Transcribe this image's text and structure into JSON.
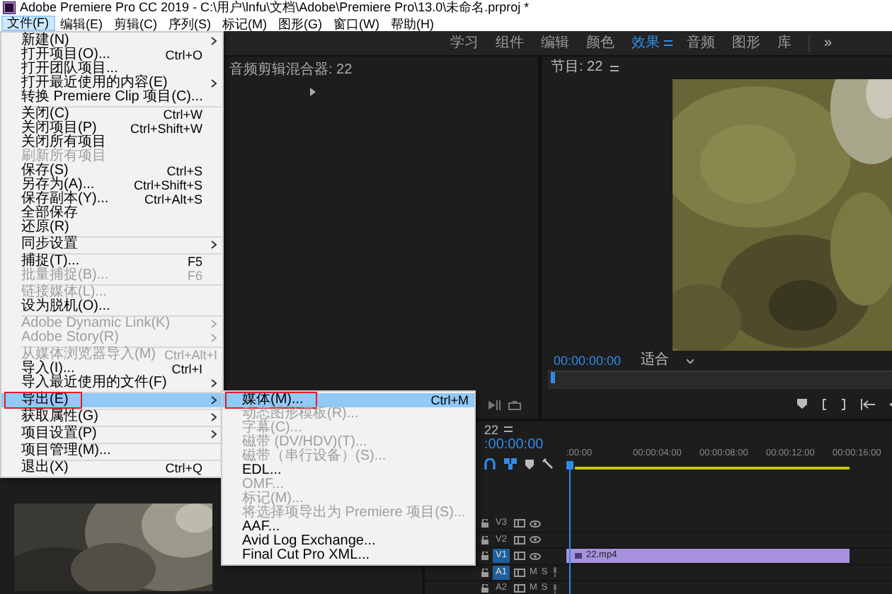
{
  "window": {
    "title": "Adobe Premiere Pro CC 2019 - C:\\用户\\lnfu\\文档\\Adobe\\Premiere Pro\\13.0\\未命名.prproj *"
  },
  "menu_bar": [
    {
      "label": "文件(F)",
      "selected": true
    },
    {
      "label": "编辑(E)",
      "selected": false
    },
    {
      "label": "剪辑(C)",
      "selected": false
    },
    {
      "label": "序列(S)",
      "selected": false
    },
    {
      "label": "标记(M)",
      "selected": false
    },
    {
      "label": "图形(G)",
      "selected": false
    },
    {
      "label": "窗口(W)",
      "selected": false
    },
    {
      "label": "帮助(H)",
      "selected": false
    }
  ],
  "file_menu": [
    {
      "kind": "item",
      "label": "新建(N)",
      "submenu": true,
      "disabled": false,
      "selected": false
    },
    {
      "kind": "item",
      "label": "打开项目(O)...",
      "shortcut": "Ctrl+O",
      "submenu": false,
      "disabled": false,
      "selected": false
    },
    {
      "kind": "item",
      "label": "打开团队项目...",
      "submenu": false,
      "disabled": false,
      "selected": false
    },
    {
      "kind": "item",
      "label": "打开最近使用的内容(E)",
      "submenu": true,
      "disabled": false,
      "selected": false
    },
    {
      "kind": "item",
      "label": "转换 Premiere Clip 项目(C)...",
      "submenu": false,
      "disabled": false,
      "selected": false
    },
    {
      "kind": "separator"
    },
    {
      "kind": "item",
      "label": "关闭(C)",
      "shortcut": "Ctrl+W",
      "submenu": false,
      "disabled": false,
      "selected": false
    },
    {
      "kind": "item",
      "label": "关闭项目(P)",
      "shortcut": "Ctrl+Shift+W",
      "submenu": false,
      "disabled": false,
      "selected": false
    },
    {
      "kind": "item",
      "label": "关闭所有项目",
      "submenu": false,
      "disabled": false,
      "selected": false
    },
    {
      "kind": "item",
      "label": "刷新所有项目",
      "submenu": false,
      "disabled": true,
      "selected": false
    },
    {
      "kind": "item",
      "label": "保存(S)",
      "shortcut": "Ctrl+S",
      "submenu": false,
      "disabled": false,
      "selected": false
    },
    {
      "kind": "item",
      "label": "另存为(A)...",
      "shortcut": "Ctrl+Shift+S",
      "submenu": false,
      "disabled": false,
      "selected": false
    },
    {
      "kind": "item",
      "label": "保存副本(Y)...",
      "shortcut": "Ctrl+Alt+S",
      "submenu": false,
      "disabled": false,
      "selected": false
    },
    {
      "kind": "item",
      "label": "全部保存",
      "submenu": false,
      "disabled": false,
      "selected": false
    },
    {
      "kind": "item",
      "label": "还原(R)",
      "submenu": false,
      "disabled": false,
      "selected": false
    },
    {
      "kind": "separator"
    },
    {
      "kind": "item",
      "label": "同步设置",
      "submenu": true,
      "disabled": false,
      "selected": false
    },
    {
      "kind": "separator"
    },
    {
      "kind": "item",
      "label": "捕捉(T)...",
      "shortcut": "F5",
      "submenu": false,
      "disabled": false,
      "selected": false
    },
    {
      "kind": "item",
      "label": "批量捕捉(B)...",
      "shortcut": "F6",
      "submenu": false,
      "disabled": true,
      "selected": false
    },
    {
      "kind": "separator"
    },
    {
      "kind": "item",
      "label": "链接媒体(L)...",
      "submenu": false,
      "disabled": true,
      "selected": false
    },
    {
      "kind": "item",
      "label": "设为脱机(O)...",
      "submenu": false,
      "disabled": false,
      "selected": false
    },
    {
      "kind": "separator"
    },
    {
      "kind": "item",
      "label": "Adobe Dynamic Link(K)",
      "submenu": true,
      "disabled": true,
      "selected": false
    },
    {
      "kind": "item",
      "label": "Adobe Story(R)",
      "submenu": true,
      "disabled": true,
      "selected": false
    },
    {
      "kind": "separator"
    },
    {
      "kind": "item",
      "label": "从媒体浏览器导入(M)",
      "shortcut": "Ctrl+Alt+I",
      "submenu": false,
      "disabled": true,
      "selected": false
    },
    {
      "kind": "item",
      "label": "导入(I)...",
      "shortcut": "Ctrl+I",
      "submenu": false,
      "disabled": false,
      "selected": false
    },
    {
      "kind": "item",
      "label": "导入最近使用的文件(F)",
      "submenu": true,
      "disabled": false,
      "selected": false
    },
    {
      "kind": "separator"
    },
    {
      "kind": "item",
      "label": "导出(E)",
      "submenu": true,
      "disabled": false,
      "selected": true,
      "annotated": true
    },
    {
      "kind": "separator"
    },
    {
      "kind": "item",
      "label": "获取属性(G)",
      "submenu": true,
      "disabled": false,
      "selected": false
    },
    {
      "kind": "separator"
    },
    {
      "kind": "item",
      "label": "项目设置(P)",
      "submenu": true,
      "disabled": false,
      "selected": false
    },
    {
      "kind": "separator"
    },
    {
      "kind": "item",
      "label": "项目管理(M)...",
      "submenu": false,
      "disabled": false,
      "selected": false
    },
    {
      "kind": "separator"
    },
    {
      "kind": "item",
      "label": "退出(X)",
      "shortcut": "Ctrl+Q",
      "submenu": false,
      "disabled": false,
      "selected": false
    }
  ],
  "export_submenu": [
    {
      "kind": "item",
      "label": "媒体(M)...",
      "shortcut": "Ctrl+M",
      "disabled": false,
      "selected": true,
      "annotated": true
    },
    {
      "kind": "item",
      "label": "动态图形模板(R)...",
      "disabled": true,
      "selected": false
    },
    {
      "kind": "item",
      "label": "字幕(C)...",
      "disabled": true,
      "selected": false
    },
    {
      "kind": "item",
      "label": "磁带 (DV/HDV)(T)...",
      "disabled": true,
      "selected": false
    },
    {
      "kind": "item",
      "label": "磁带（串行设备）(S)...",
      "disabled": true,
      "selected": false
    },
    {
      "kind": "item",
      "label": "EDL...",
      "disabled": false,
      "selected": false
    },
    {
      "kind": "item",
      "label": "OMF...",
      "disabled": true,
      "selected": false
    },
    {
      "kind": "item",
      "label": "标记(M)...",
      "disabled": true,
      "selected": false
    },
    {
      "kind": "item",
      "label": "将选择项导出为 Premiere 项目(S)...",
      "disabled": true,
      "selected": false
    },
    {
      "kind": "item",
      "label": "AAF...",
      "disabled": false,
      "selected": false
    },
    {
      "kind": "item",
      "label": "Avid Log Exchange...",
      "disabled": false,
      "selected": false
    },
    {
      "kind": "item",
      "label": "Final Cut Pro XML...",
      "disabled": false,
      "selected": false
    }
  ],
  "workspaces": [
    {
      "label": "学习",
      "selected": false
    },
    {
      "label": "组件",
      "selected": false
    },
    {
      "label": "编辑",
      "selected": false
    },
    {
      "label": "颜色",
      "selected": false
    },
    {
      "label": "效果",
      "selected": true
    },
    {
      "label": "音频",
      "selected": false
    },
    {
      "label": "图形",
      "selected": false
    },
    {
      "label": "库",
      "selected": false
    }
  ],
  "workspace_more": "»",
  "audio_mixer": {
    "title": "音频剪辑混合器: 22"
  },
  "program_monitor": {
    "title": "节目: 22",
    "timecode": "00:00:00:00",
    "zoom": "适合"
  },
  "timeline": {
    "title": "22",
    "timecode": ":00:00:00",
    "ruler": [
      ":00:00",
      "00:00:04:00",
      "00:00:08:00",
      "00:00:12:00",
      "00:00:16:00"
    ],
    "tracks": [
      {
        "name": "V3",
        "kind": "video",
        "selected": false
      },
      {
        "name": "V2",
        "kind": "video",
        "selected": false
      },
      {
        "name": "V1",
        "kind": "video",
        "selected": true,
        "clip": "22.mp4"
      },
      {
        "name": "A1",
        "kind": "audio",
        "selected": true,
        "mute": "M",
        "solo": "S"
      },
      {
        "name": "A2",
        "kind": "audio",
        "selected": false,
        "mute": "M",
        "solo": "S"
      }
    ]
  }
}
